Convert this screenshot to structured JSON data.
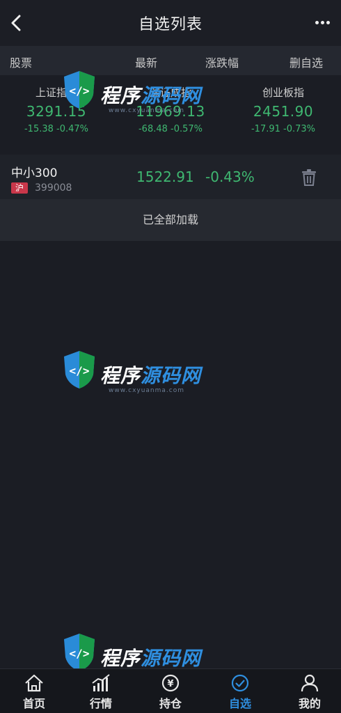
{
  "header": {
    "title": "自选列表",
    "back_icon": "chevron-left-icon",
    "more_icon": "more-dots-icon"
  },
  "columns": {
    "stock": "股票",
    "latest": "最新",
    "change": "涨跌幅",
    "delete": "删自选"
  },
  "indices": [
    {
      "name": "上证指数",
      "value": "3291.15",
      "change": "-15.38 -0.47%"
    },
    {
      "name": "深证成指",
      "value": "11969.13",
      "change": "-68.48 -0.57%"
    },
    {
      "name": "创业板指",
      "value": "2451.90",
      "change": "-17.91 -0.73%"
    }
  ],
  "watchlist": [
    {
      "name": "中小300",
      "market": "沪",
      "code": "399008",
      "price": "1522.91",
      "pct": "-0.43%"
    }
  ],
  "loaded_text": "已全部加载",
  "watermark": {
    "text_a": "程序",
    "text_b": "源码网",
    "url": "www.cxyuanma.com"
  },
  "tabs": [
    {
      "label": "首页",
      "icon": "home-icon",
      "active": false
    },
    {
      "label": "行情",
      "icon": "chart-icon",
      "active": false
    },
    {
      "label": "持仓",
      "icon": "holdings-icon",
      "active": false
    },
    {
      "label": "自选",
      "icon": "check-circle-icon",
      "active": true
    },
    {
      "label": "我的",
      "icon": "user-icon",
      "active": false
    }
  ],
  "colors": {
    "down_green": "#3fb871",
    "accent_blue": "#2f8fe0",
    "market_tag": "#c9374a"
  }
}
